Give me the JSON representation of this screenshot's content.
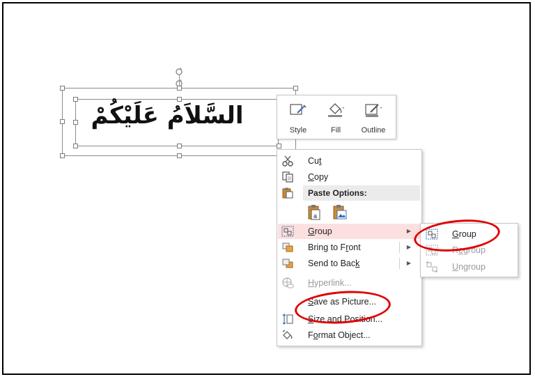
{
  "slide": {
    "text": "السَّلاَمُ عَلَيْكُمْ"
  },
  "mini_toolbar": {
    "style_label": "Style",
    "fill_label": "Fill",
    "outline_label": "Outline"
  },
  "context_menu": {
    "cut": {
      "pre": "Cu",
      "key": "t",
      "post": ""
    },
    "copy": {
      "pre": "",
      "key": "C",
      "post": "opy"
    },
    "paste_options": "Paste Options:",
    "group": {
      "pre": "",
      "key": "G",
      "post": "roup"
    },
    "bring_to_front": {
      "pre": "Bring to F",
      "key": "r",
      "post": "ont"
    },
    "send_to_back": {
      "pre": "Send to Bac",
      "key": "k",
      "post": ""
    },
    "hyperlink": {
      "pre": "",
      "key": "H",
      "post": "yperlink..."
    },
    "save_as_picture": {
      "pre": "",
      "key": "S",
      "post": "ave as Picture..."
    },
    "size_and_position": {
      "pre": "",
      "key": "S",
      "post": "ize and Position..."
    },
    "format_object": {
      "pre": "F",
      "key": "o",
      "post": "rmat Object..."
    }
  },
  "submenu": {
    "group": {
      "pre": "",
      "key": "G",
      "post": "roup"
    },
    "regroup": {
      "pre": "R",
      "key": "e",
      "post": "group"
    },
    "ungroup": {
      "pre": "",
      "key": "U",
      "post": "ngroup"
    }
  },
  "colors": {
    "highlight": "#fce0df",
    "annotation": "#e00000",
    "disabled": "#9a9a9a"
  }
}
